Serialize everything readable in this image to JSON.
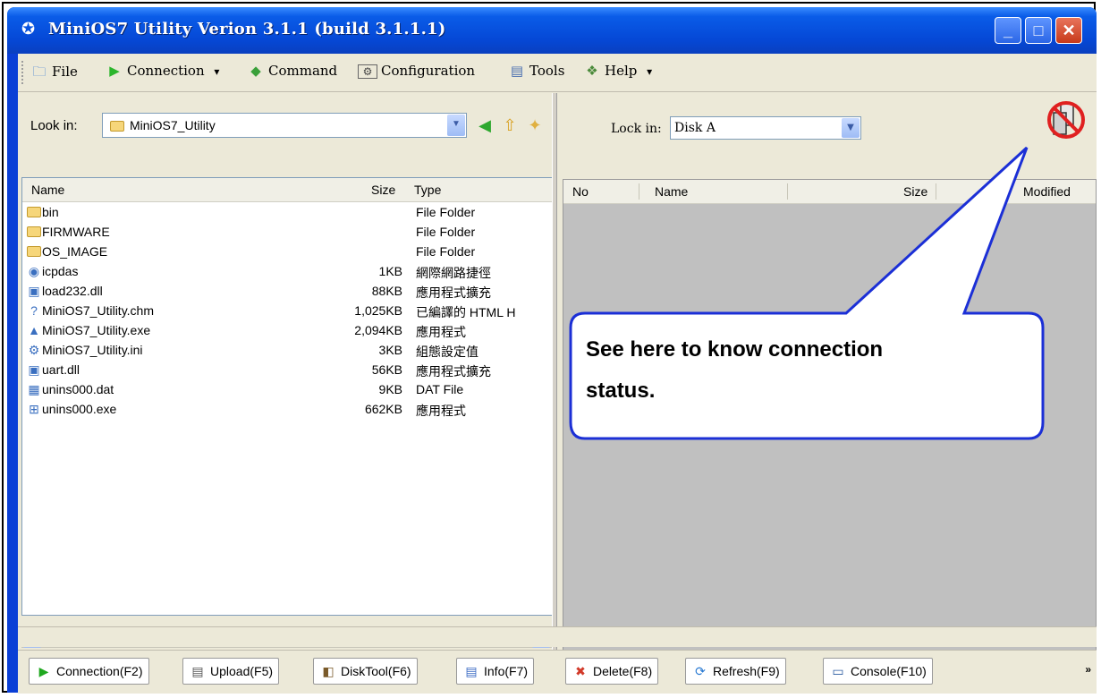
{
  "window": {
    "title": "MiniOS7 Utility Verion 3.1.1 (build 3.1.1.1)",
    "minimize": "_",
    "maximize": "□",
    "close": "✕"
  },
  "menu": [
    {
      "label": "File",
      "icon": "file-icon",
      "glyph": "🗂"
    },
    {
      "label": "Connection",
      "icon": "play-icon",
      "glyph": "▶",
      "dropdown": "▾"
    },
    {
      "label": "Command",
      "icon": "command-icon",
      "glyph": "◆"
    },
    {
      "label": "Configuration",
      "icon": "configuration-icon",
      "glyph": "⚙"
    },
    {
      "label": "Tools",
      "icon": "tools-icon",
      "glyph": "▤"
    },
    {
      "label": "Help",
      "icon": "help-icon",
      "glyph": "❖",
      "dropdown": "▾"
    }
  ],
  "left": {
    "look_in_label": "Look in:",
    "look_in_value": "MiniOS7_Utility",
    "columns": {
      "name": "Name",
      "size": "Size",
      "type": "Type"
    },
    "files": [
      {
        "name": "bin",
        "size": "",
        "type": "File Folder",
        "icon": "folder-icon",
        "glyph": "folder"
      },
      {
        "name": "FIRMWARE",
        "size": "",
        "type": "File Folder",
        "icon": "folder-icon",
        "glyph": "folder"
      },
      {
        "name": "OS_IMAGE",
        "size": "",
        "type": "File Folder",
        "icon": "folder-icon",
        "glyph": "folder"
      },
      {
        "name": "icpdas",
        "size": "1KB",
        "type": "網際網路捷徑",
        "icon": "internet-shortcut-icon",
        "glyph": "◉"
      },
      {
        "name": "load232.dll",
        "size": "88KB",
        "type": "應用程式擴充",
        "icon": "dll-icon",
        "glyph": "▣"
      },
      {
        "name": "MiniOS7_Utility.chm",
        "size": "1,025KB",
        "type": "已編譯的 HTML H",
        "icon": "help-file-icon",
        "glyph": "?"
      },
      {
        "name": "MiniOS7_Utility.exe",
        "size": "2,094KB",
        "type": "應用程式",
        "icon": "app-icon",
        "glyph": "▲"
      },
      {
        "name": "MiniOS7_Utility.ini",
        "size": "3KB",
        "type": "組態設定值",
        "icon": "ini-icon",
        "glyph": "⚙"
      },
      {
        "name": "uart.dll",
        "size": "56KB",
        "type": "應用程式擴充",
        "icon": "dll-icon",
        "glyph": "▣"
      },
      {
        "name": "unins000.dat",
        "size": "9KB",
        "type": "DAT File",
        "icon": "dat-icon",
        "glyph": "▦"
      },
      {
        "name": "unins000.exe",
        "size": "662KB",
        "type": "應用程式",
        "icon": "installer-icon",
        "glyph": "⊞"
      }
    ],
    "scroll_left": "◀",
    "scroll_right": "▶",
    "scroll_thumb": "|||"
  },
  "right": {
    "look_in_label": "Lock in:",
    "look_in_value": "Disk A",
    "columns": {
      "no": "No",
      "name": "Name",
      "size": "Size",
      "modified": "Modified"
    }
  },
  "callout": {
    "line1": "See here to know connection",
    "line2": "status."
  },
  "buttons": [
    {
      "label": "Connection(F2)",
      "icon": "play-icon",
      "glyph": "▶",
      "color": "#1fa81f"
    },
    {
      "label": "Upload(F5)",
      "icon": "upload-icon",
      "glyph": "▤",
      "color": "#555555"
    },
    {
      "label": "DiskTool(F6)",
      "icon": "disktool-icon",
      "glyph": "◧",
      "color": "#7a5a2a"
    },
    {
      "label": "Info(F7)",
      "icon": "info-icon",
      "glyph": "▤",
      "color": "#3b6bc4"
    },
    {
      "label": "Delete(F8)",
      "icon": "delete-icon",
      "glyph": "✖",
      "color": "#d23a2a"
    },
    {
      "label": "Refresh(F9)",
      "icon": "refresh-icon",
      "glyph": "⟳",
      "color": "#2a7ad2"
    },
    {
      "label": "Console(F10)",
      "icon": "console-icon",
      "glyph": "▭",
      "color": "#2a5aa0"
    }
  ],
  "more": "»"
}
